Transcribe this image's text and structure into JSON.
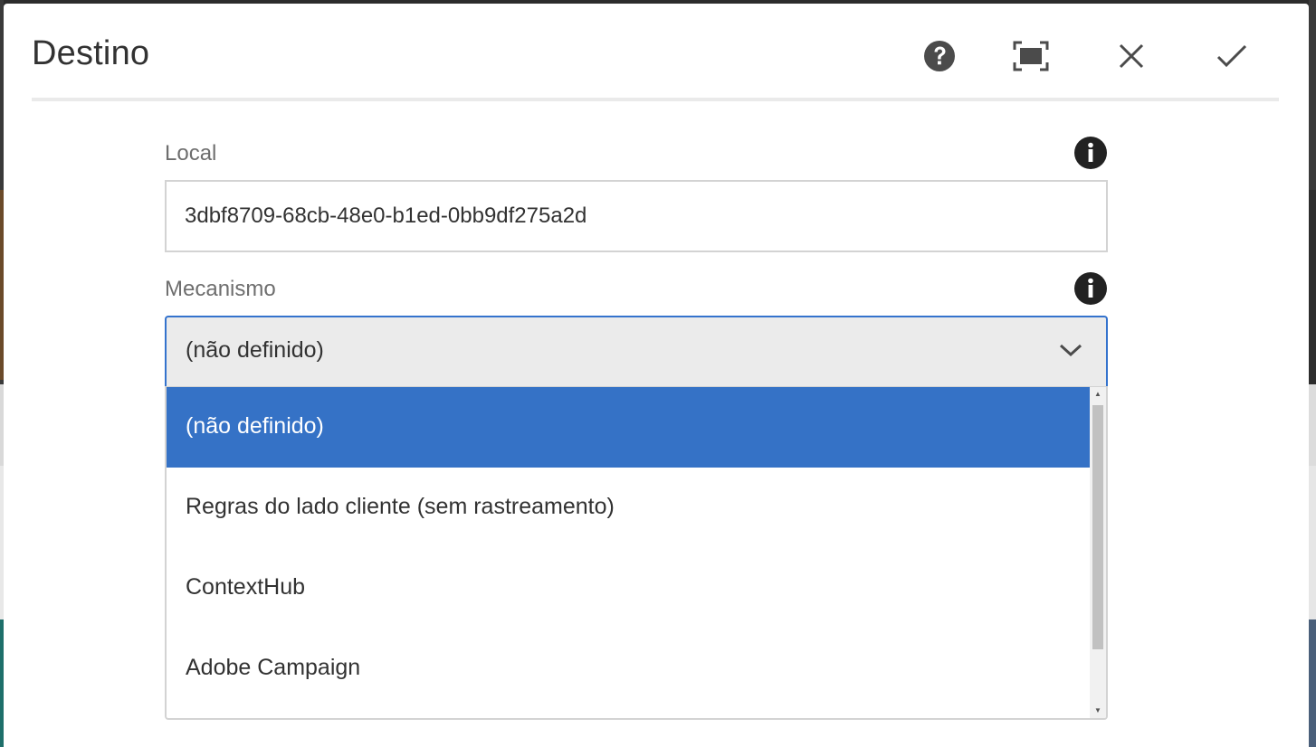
{
  "dialog": {
    "title": "Destino",
    "help_icon": "question-circle-icon",
    "fullscreen_icon": "fullscreen-icon",
    "close_icon": "close-icon",
    "done_icon": "checkmark-icon"
  },
  "fields": {
    "local": {
      "label": "Local",
      "value": "3dbf8709-68cb-48e0-b1ed-0bb9df275a2d",
      "info_icon": "info-icon"
    },
    "mecanismo": {
      "label": "Mecanismo",
      "selected": "(não definido)",
      "info_icon": "info-icon",
      "options": [
        "(não definido)",
        "Regras do lado cliente (sem rastreamento)",
        "ContextHub",
        "Adobe Campaign"
      ]
    }
  },
  "colors": {
    "accent": "#3473cd",
    "selected_option": "#3572c6",
    "text": "#323232",
    "label": "#6e6e6e"
  }
}
